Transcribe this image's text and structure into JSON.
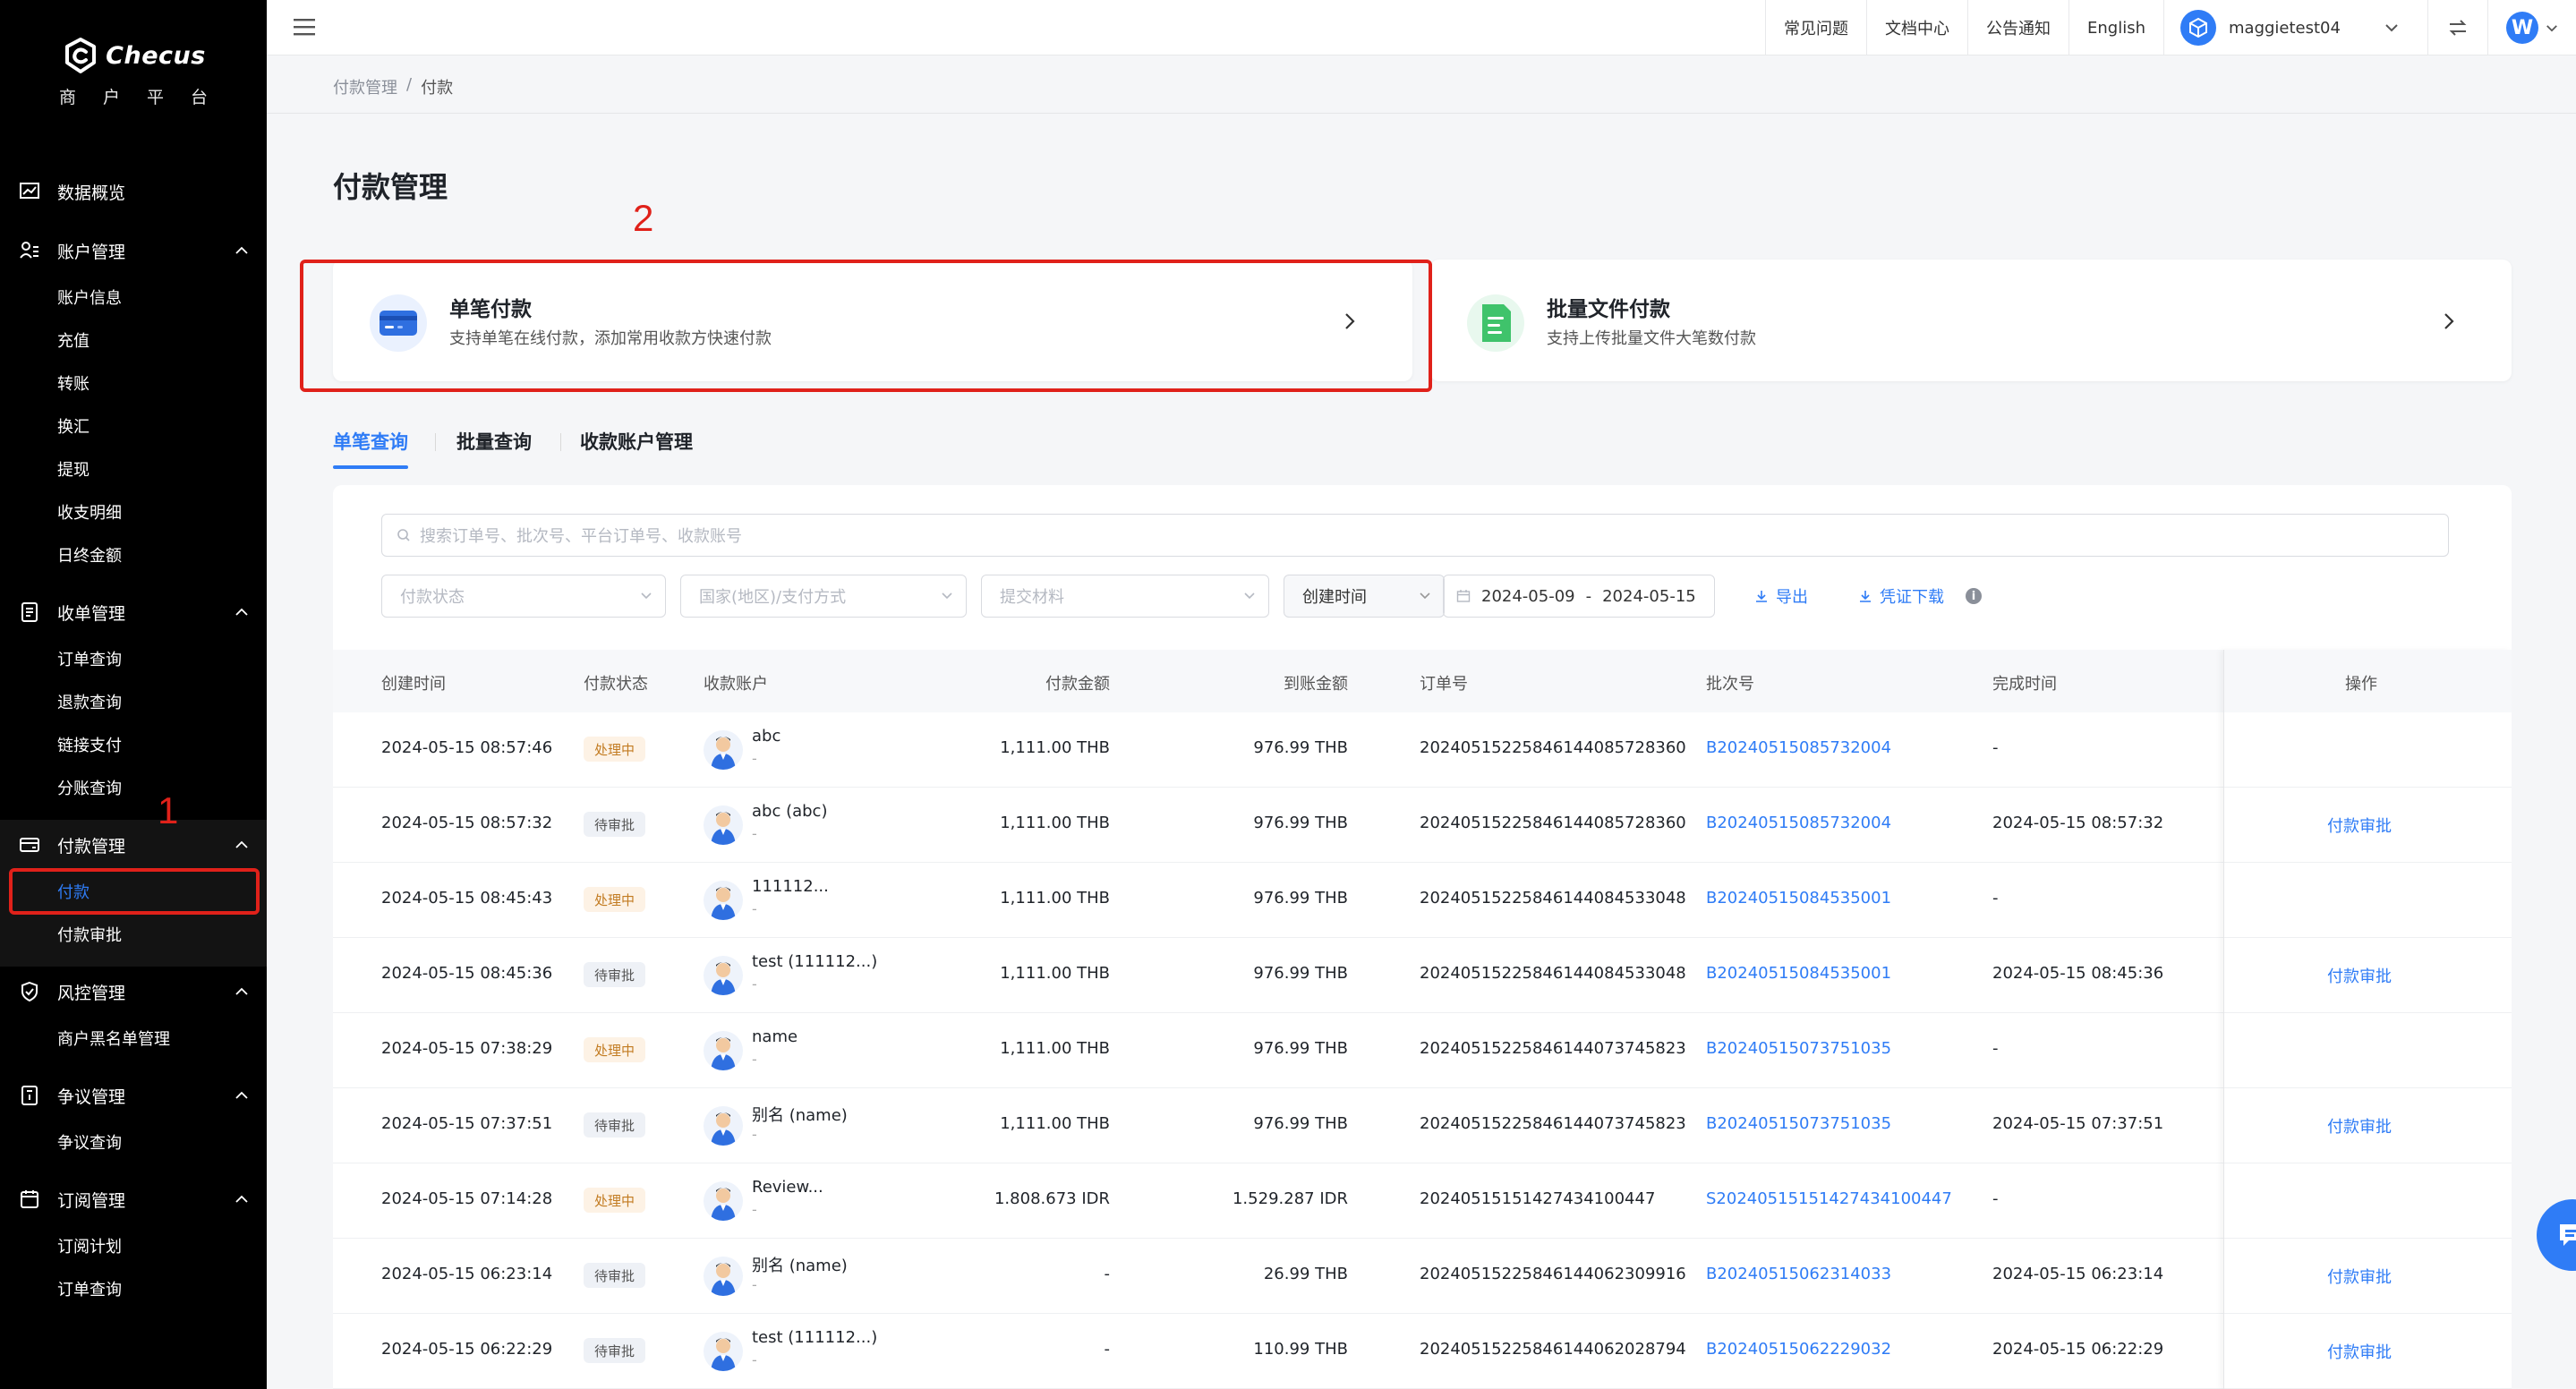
{
  "brand": {
    "name": "Checus",
    "subtitle": "商户平台"
  },
  "sidebar": {
    "groups": [
      {
        "label": "数据概览",
        "icon": "chart-icon",
        "items": []
      },
      {
        "label": "账户管理",
        "icon": "account-icon",
        "items": [
          "账户信息",
          "充值",
          "转账",
          "换汇",
          "提现",
          "收支明细",
          "日终金额"
        ]
      },
      {
        "label": "收单管理",
        "icon": "receipt-icon",
        "items": [
          "订单查询",
          "退款查询",
          "链接支付",
          "分账查询"
        ]
      },
      {
        "label": "付款管理",
        "icon": "payment-icon",
        "items": [
          "付款",
          "付款审批"
        ]
      },
      {
        "label": "风控管理",
        "icon": "shield-icon",
        "items": [
          "商户黑名单管理"
        ]
      },
      {
        "label": "争议管理",
        "icon": "dispute-icon",
        "items": [
          "争议查询"
        ]
      },
      {
        "label": "订阅管理",
        "icon": "calendar-icon",
        "items": [
          "订阅计划",
          "订单查询"
        ]
      }
    ],
    "active_item": "付款"
  },
  "topbar": {
    "links": [
      "常见问题",
      "文档中心",
      "公告通知",
      "English"
    ],
    "username": "maggietest04",
    "avatar_letter": "W"
  },
  "annotations": {
    "sidebar_marker": "1",
    "card_marker": "2"
  },
  "breadcrumb": [
    "付款管理",
    "付款"
  ],
  "page_title": "付款管理",
  "cards": [
    {
      "title": "单笔付款",
      "desc": "支持单笔在线付款，添加常用收款方快速付款",
      "icon": "card-icon"
    },
    {
      "title": "批量文件付款",
      "desc": "支持上传批量文件大笔数付款",
      "icon": "file-icon"
    }
  ],
  "tabs": [
    "单笔查询",
    "批量查询",
    "收款账户管理"
  ],
  "search": {
    "placeholder": "搜索订单号、批次号、平台订单号、收款账号"
  },
  "filters": {
    "status": "付款状态",
    "country": "国家(地区)/支付方式",
    "material": "提交材料",
    "time_type": "创建时间",
    "date_start": "2024-05-09",
    "date_sep": "-",
    "date_end": "2024-05-15",
    "export": "导出",
    "voucher": "凭证下载"
  },
  "table": {
    "columns": [
      "创建时间",
      "付款状态",
      "收款账户",
      "付款金额",
      "到账金额",
      "订单号",
      "批次号",
      "完成时间",
      "操作"
    ],
    "rows": [
      {
        "created": "2024-05-15 08:57:46",
        "status": "处理中",
        "account": "abc",
        "sub": "-",
        "pay": "1,111.00 THB",
        "recv": "976.99 THB",
        "order": "20240515225846144085728360",
        "batch": "B20240515085732004",
        "done": "-",
        "op": ""
      },
      {
        "created": "2024-05-15 08:57:32",
        "status": "待审批",
        "account": "abc (abc)",
        "sub": "-",
        "pay": "1,111.00 THB",
        "recv": "976.99 THB",
        "order": "20240515225846144085728360",
        "batch": "B20240515085732004",
        "done": "2024-05-15 08:57:32",
        "op": "付款审批"
      },
      {
        "created": "2024-05-15 08:45:43",
        "status": "处理中",
        "account": "111112...",
        "sub": "-",
        "pay": "1,111.00 THB",
        "recv": "976.99 THB",
        "order": "20240515225846144084533048",
        "batch": "B20240515084535001",
        "done": "-",
        "op": ""
      },
      {
        "created": "2024-05-15 08:45:36",
        "status": "待审批",
        "account": "test (111112...)",
        "sub": "-",
        "pay": "1,111.00 THB",
        "recv": "976.99 THB",
        "order": "20240515225846144084533048",
        "batch": "B20240515084535001",
        "done": "2024-05-15 08:45:36",
        "op": "付款审批"
      },
      {
        "created": "2024-05-15 07:38:29",
        "status": "处理中",
        "account": "name",
        "sub": "-",
        "pay": "1,111.00 THB",
        "recv": "976.99 THB",
        "order": "20240515225846144073745823",
        "batch": "B20240515073751035",
        "done": "-",
        "op": ""
      },
      {
        "created": "2024-05-15 07:37:51",
        "status": "待审批",
        "account": "别名 (name)",
        "sub": "-",
        "pay": "1,111.00 THB",
        "recv": "976.99 THB",
        "order": "20240515225846144073745823",
        "batch": "B20240515073751035",
        "done": "2024-05-15 07:37:51",
        "op": "付款审批"
      },
      {
        "created": "2024-05-15 07:14:28",
        "status": "处理中",
        "account": "Review...",
        "sub": "-",
        "pay": "1.808.673 IDR",
        "recv": "1.529.287 IDR",
        "order": "20240515151427434100447",
        "batch": "S20240515151427434100447",
        "done": "-",
        "op": ""
      },
      {
        "created": "2024-05-15 06:23:14",
        "status": "待审批",
        "account": "别名 (name)",
        "sub": "-",
        "pay": "-",
        "recv": "26.99 THB",
        "order": "20240515225846144062309916",
        "batch": "B20240515062314033",
        "done": "2024-05-15 06:23:14",
        "op": "付款审批"
      },
      {
        "created": "2024-05-15 06:22:29",
        "status": "待审批",
        "account": "test (111112...)",
        "sub": "-",
        "pay": "-",
        "recv": "110.99 THB",
        "order": "20240515225846144062028794",
        "batch": "B20240515062229032",
        "done": "2024-05-15 06:22:29",
        "op": "付款审批"
      }
    ]
  },
  "colors": {
    "accent": "#2f7cf6",
    "annotation": "#e0211a",
    "sidebar_bg": "#000000",
    "status_processing": "#c27b21"
  }
}
